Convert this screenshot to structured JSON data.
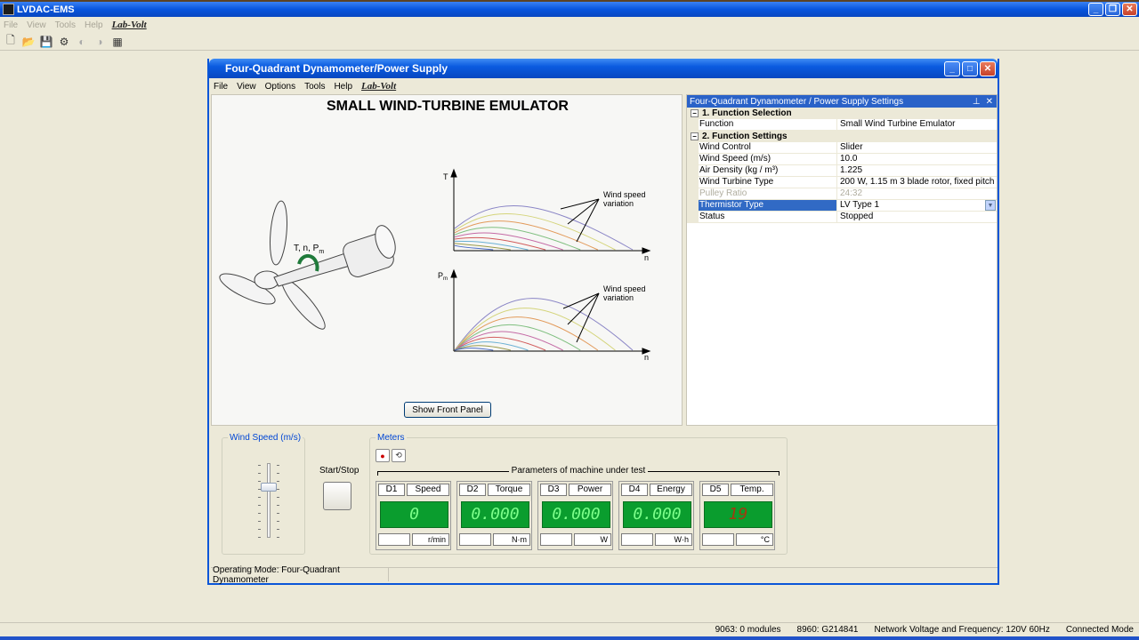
{
  "app": {
    "title": "LVDAC-EMS",
    "menu": [
      "File",
      "View",
      "Tools",
      "Help"
    ],
    "brand": "Lab-Volt"
  },
  "window": {
    "title": "Four-Quadrant Dynamometer/Power Supply",
    "menu": [
      "File",
      "View",
      "Options",
      "Tools",
      "Help"
    ],
    "brand": "Lab-Volt"
  },
  "diagram": {
    "title": "SMALL WIND-TURBINE EMULATOR",
    "torque_axis": "T",
    "power_axis": "P",
    "power_sub": "m",
    "speed_axis": "n",
    "annotation1": [
      "Wind speed",
      "variation"
    ],
    "annotation2": [
      "Wind speed",
      "variation"
    ],
    "shaft_label": "T, n, P",
    "shaft_label_sub": "m",
    "show_front_panel": "Show Front Panel"
  },
  "settings": {
    "title": "Four-Quadrant Dynamometer / Power Supply Settings",
    "categories": [
      {
        "name": "1. Function Selection",
        "rows": [
          {
            "key": "Function",
            "value": "Small Wind Turbine Emulator"
          }
        ]
      },
      {
        "name": "2. Function Settings",
        "rows": [
          {
            "key": "Wind Control",
            "value": "Slider"
          },
          {
            "key": "Wind Speed (m/s)",
            "value": "10.0"
          },
          {
            "key": "Air Density (kg / m³)",
            "value": "1.225"
          },
          {
            "key": "Wind Turbine Type",
            "value": "200 W, 1.15 m 3 blade rotor, fixed pitch"
          },
          {
            "key": "Pulley Ratio",
            "value": "24:32"
          },
          {
            "key": "Thermistor Type",
            "value": "LV Type 1"
          },
          {
            "key": "Status",
            "value": "Stopped"
          }
        ]
      }
    ]
  },
  "controls": {
    "wind_speed_label": "Wind Speed (m/s)",
    "start_stop_label": "Start/Stop",
    "meters_label": "Meters",
    "params_label": "Parameters of machine under test"
  },
  "meters": [
    {
      "id": "D1",
      "name": "Speed",
      "value": "0",
      "unit": "r/min"
    },
    {
      "id": "D2",
      "name": "Torque",
      "value": "0.000",
      "unit": "N·m"
    },
    {
      "id": "D3",
      "name": "Power",
      "value": "0.000",
      "unit": "W"
    },
    {
      "id": "D4",
      "name": "Energy",
      "value": "0.000",
      "unit": "W·h"
    },
    {
      "id": "D5",
      "name": "Temp.",
      "value": "19",
      "unit": "°C"
    }
  ],
  "status": {
    "operating_mode": "Operating Mode: Four-Quadrant Dynamometer",
    "outer": [
      "9063: 0 modules",
      "8960: G214841",
      "Network Voltage and Frequency: 120V 60Hz",
      "Connected Mode"
    ]
  },
  "colors": {
    "xp_blue": "#0A56D8",
    "meter_green": "#0A9D2E",
    "selection": "#316AC5"
  }
}
